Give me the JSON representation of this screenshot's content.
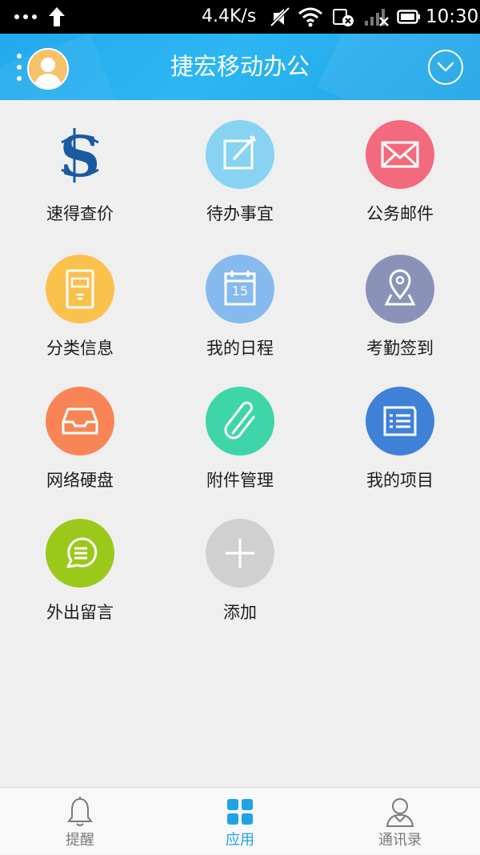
{
  "status_bar": {
    "speed": "4.4K/s",
    "time": "10:30"
  },
  "header": {
    "title": "捷宏移动办公"
  },
  "apps": [
    {
      "label": "速得查价",
      "icon": "sude-logo-icon",
      "color": "#1a5aa0"
    },
    {
      "label": "待办事宜",
      "icon": "edit-icon",
      "color": "#87d3f1"
    },
    {
      "label": "公务邮件",
      "icon": "mail-icon",
      "color": "#f36a7d"
    },
    {
      "label": "分类信息",
      "icon": "archive-icon",
      "color": "#fbc14d"
    },
    {
      "label": "我的日程",
      "icon": "calendar-icon",
      "color": "#86b9ee"
    },
    {
      "label": "考勤签到",
      "icon": "location-icon",
      "color": "#8a92b8"
    },
    {
      "label": "网络硬盘",
      "icon": "inbox-tray-icon",
      "color": "#f98557"
    },
    {
      "label": "附件管理",
      "icon": "paperclip-icon",
      "color": "#3ed6a9"
    },
    {
      "label": "我的项目",
      "icon": "document-list-icon",
      "color": "#3f81d7"
    },
    {
      "label": "外出留言",
      "icon": "chat-bubble-icon",
      "color": "#9ac91c"
    },
    {
      "label": "添加",
      "icon": "plus-icon",
      "color": "#d0d0d0"
    }
  ],
  "calendar_day": "15",
  "bottom_nav": [
    {
      "label": "提醒",
      "icon": "bell-icon"
    },
    {
      "label": "应用",
      "icon": "grid-icon",
      "active": true
    },
    {
      "label": "通讯录",
      "icon": "contacts-icon"
    }
  ]
}
